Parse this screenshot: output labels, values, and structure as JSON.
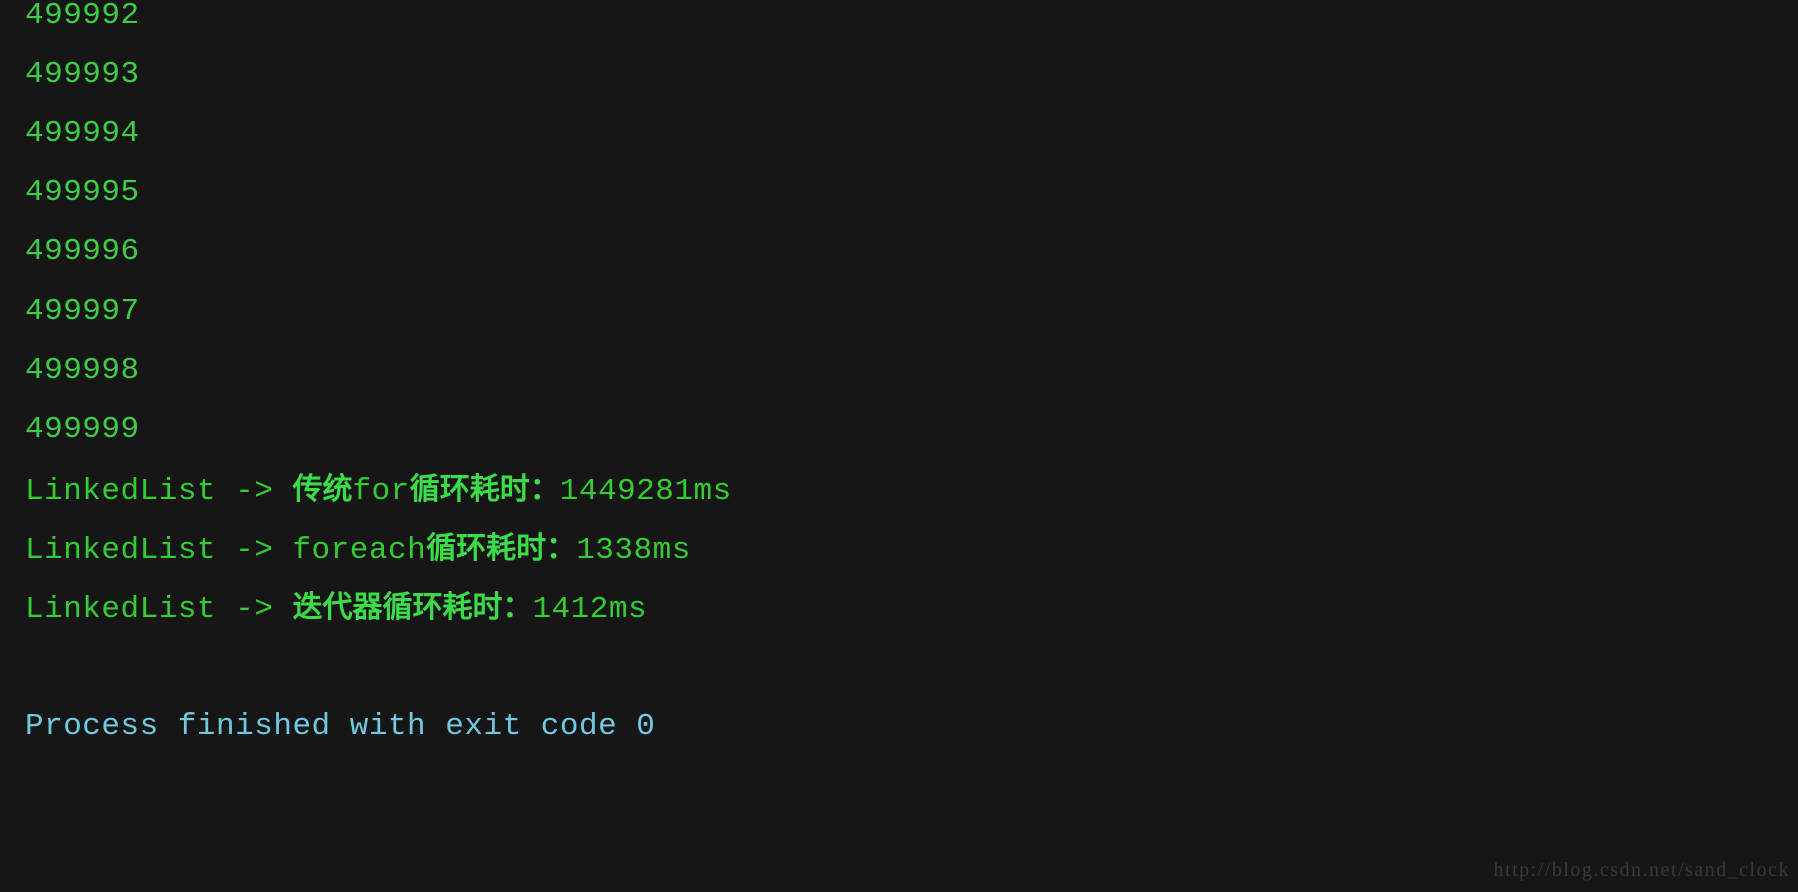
{
  "console": {
    "background_color": "#161616",
    "output_color": "#33cc33",
    "cjk_color": "#3bdb4a",
    "exit_color": "#6fc9e0",
    "watermark_color": "#3a3a34",
    "counter_lines": [
      "499992",
      "499993",
      "499994",
      "499995",
      "499996",
      "499997",
      "499998",
      "499999"
    ],
    "result_lines": [
      {
        "prefix": "LinkedList -> ",
        "cjk_a": "传统",
        "mono_a": "for",
        "cjk_b": "循环耗时：",
        "value": "1449281ms"
      },
      {
        "prefix": "LinkedList -> ",
        "cjk_a": "",
        "mono_a": "foreach",
        "cjk_b": "循环耗时：",
        "value": "1338ms"
      },
      {
        "prefix": "LinkedList -> ",
        "cjk_a": "迭代器",
        "mono_a": "",
        "cjk_b": "循环耗时：",
        "value": "1412ms"
      }
    ],
    "exit_line": "Process finished with exit code 0",
    "watermark": "http://blog.csdn.net/sand_clock"
  }
}
